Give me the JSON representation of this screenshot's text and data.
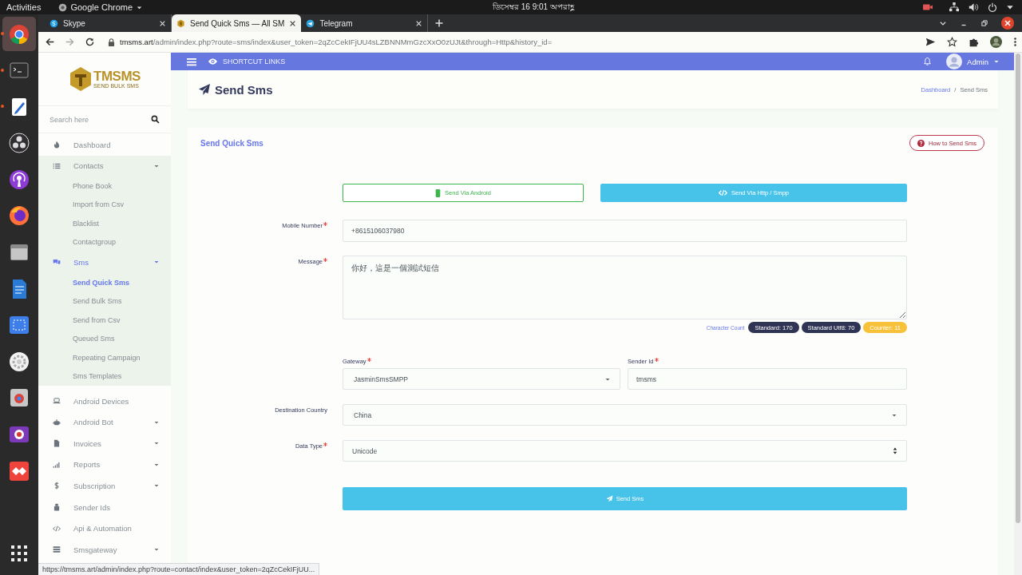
{
  "desktop_bar": {
    "activities": "Activities",
    "app_menu": "Google Chrome",
    "clock": "ডিসেম্বর 16  9:01 অপরাহ্ণ"
  },
  "dock_apps": [
    {
      "running": true,
      "active": true
    },
    {
      "running": true,
      "active": false
    },
    {
      "running": true,
      "active": false
    },
    {
      "running": false,
      "active": false
    },
    {
      "running": false,
      "active": false
    },
    {
      "running": false,
      "active": false
    },
    {
      "running": false,
      "active": false
    },
    {
      "running": false,
      "active": false
    },
    {
      "running": false,
      "active": false
    },
    {
      "running": false,
      "active": false
    },
    {
      "running": false,
      "active": false
    },
    {
      "running": false,
      "active": false
    },
    {
      "running": false,
      "active": false
    },
    {
      "running": false,
      "active": false
    }
  ],
  "browser": {
    "tabs": [
      {
        "title": "Skype",
        "selected": false
      },
      {
        "title": "Send Quick Sms — All SM",
        "selected": true
      },
      {
        "title": "Telegram",
        "selected": false
      }
    ],
    "url_host": "tmsms.art",
    "url_path": "/admin/index.php?route=sms/index&user_token=2qZcCekIFjUU4sLZBNNMmGzcXxO0zUJt&through=Http&history_id=",
    "status_url": "https://tmsms.art/admin/index.php?route=contact/index&user_token=2qZcCekIFjUU..."
  },
  "sidebar": {
    "logo": {
      "name": "TMSMS",
      "tagline": "SEND BULK SMS"
    },
    "search": {
      "placeholder": "Search here"
    },
    "items": [
      {
        "label": "Dashboard",
        "selected": false,
        "has_submenu": false
      },
      {
        "label": "Contacts",
        "selected": false,
        "has_submenu": true,
        "expanded": true,
        "children": [
          {
            "label": "Phone Book",
            "selected": false
          },
          {
            "label": "Import from Csv",
            "selected": false
          },
          {
            "label": "Blacklist",
            "selected": false
          },
          {
            "label": "Contactgroup",
            "selected": false
          }
        ]
      },
      {
        "label": "Sms",
        "selected": true,
        "has_submenu": true,
        "expanded": true,
        "children": [
          {
            "label": "Send Quick Sms",
            "selected": true
          },
          {
            "label": "Send Bulk Sms",
            "selected": false
          },
          {
            "label": "Send from Csv",
            "selected": false
          },
          {
            "label": "Queued Sms",
            "selected": false
          },
          {
            "label": "Repeating Campaign",
            "selected": false
          },
          {
            "label": "Sms Templates",
            "selected": false
          }
        ]
      },
      {
        "label": "Android Devices",
        "selected": false,
        "has_submenu": false
      },
      {
        "label": "Android Bot",
        "selected": false,
        "has_submenu": true,
        "expanded": false
      },
      {
        "label": "Invoices",
        "selected": false,
        "has_submenu": true,
        "expanded": false
      },
      {
        "label": "Reports",
        "selected": false,
        "has_submenu": true,
        "expanded": false
      },
      {
        "label": "Subscription",
        "selected": false,
        "has_submenu": true,
        "expanded": false
      },
      {
        "label": "Sender Ids",
        "selected": false,
        "has_submenu": false
      },
      {
        "label": "Api & Automation",
        "selected": false,
        "has_submenu": false
      },
      {
        "label": "Smsgateway",
        "selected": false,
        "has_submenu": true,
        "expanded": false
      }
    ]
  },
  "topbar": {
    "shortcut_links": "SHORTCUT LINKS",
    "user": "Admin"
  },
  "page_header": {
    "title": "Send Sms",
    "breadcrumbs": [
      "Dashboard",
      "Send Sms"
    ],
    "separator": "/"
  },
  "card": {
    "title": "Send Quick Sms",
    "help_button": "How to Send Sms",
    "mode_buttons": [
      {
        "label": "Send Via Android",
        "selected": false
      },
      {
        "label": "Send Via Http / Smpp",
        "selected": true
      }
    ],
    "mobile_number": {
      "label": "Mobile Number",
      "required": true,
      "value": "+8615106037980"
    },
    "message": {
      "label": "Message",
      "required": true,
      "value": "你好，這是一個測試短信"
    },
    "character_count": {
      "label": "Character Count",
      "badges": [
        {
          "text": "Standard: 170",
          "color": "#2f3454"
        },
        {
          "text": "Standard Utf8: 70",
          "color": "#2f3454"
        },
        {
          "text": "Counter: 11",
          "color": "#f8c13a"
        }
      ]
    },
    "gateway": {
      "label": "Gateway",
      "required": true,
      "value": "JasminSmsSMPP"
    },
    "sender_id": {
      "label": "Sender Id",
      "required": true,
      "value": "tmsms"
    },
    "destination_country": {
      "label": "Destination Country",
      "required": false,
      "value": "China"
    },
    "data_type": {
      "label": "Data Type",
      "required": true,
      "value": "Unicode"
    },
    "submit": "Send Sms"
  }
}
